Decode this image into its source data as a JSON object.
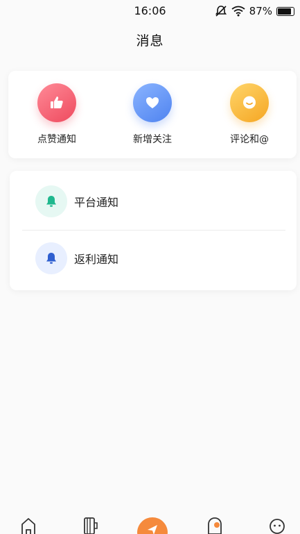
{
  "status_bar": {
    "time": "16:06",
    "battery": "87%",
    "battery_level": 0.87
  },
  "header": {
    "title": "消息"
  },
  "quick_actions": [
    {
      "label": "点赞通知",
      "icon": "thumbs-up-icon",
      "color": "#ee4a5e"
    },
    {
      "label": "新增关注",
      "icon": "heart-icon",
      "color": "#4f83f0"
    },
    {
      "label": "评论和@",
      "icon": "smile-chat-icon",
      "color": "#f5a623"
    }
  ],
  "notifications": [
    {
      "label": "平台通知",
      "icon": "bell-icon",
      "color": "#1fb88e"
    },
    {
      "label": "返利通知",
      "icon": "bell-icon",
      "color": "#2f5fd0"
    }
  ],
  "bottom_nav": {
    "items": [
      {
        "icon": "home-icon"
      },
      {
        "icon": "list-icon"
      },
      {
        "icon": "send-icon",
        "color": "#f58a3c"
      },
      {
        "icon": "message-icon"
      },
      {
        "icon": "profile-icon"
      }
    ]
  }
}
